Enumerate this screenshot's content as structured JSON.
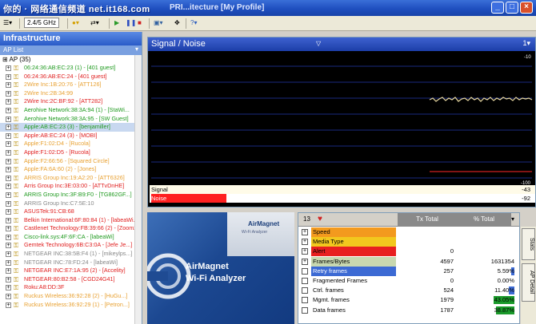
{
  "window": {
    "watermark": "你的 · 网络通信频道 net.it168.com",
    "title": "PRI...itecture [My Profile]"
  },
  "toolbar": {
    "band": "2.4/5 GHz",
    "items": [
      "☰▾",
      "2.4/5 GHz",
      "●▾",
      "⇄▾",
      "▶",
      "❚❚",
      "■",
      "▣▾",
      "✥",
      "?▾"
    ]
  },
  "left": {
    "header": "Infrastructure",
    "subheader": "AP List",
    "root": "AP (35)",
    "items": [
      {
        "label": "06:24:36:AB:EC:23 (1) - [401 guest]",
        "color": "#1f9a1f"
      },
      {
        "label": "06:24:36:AB:EC:24 - [401 guest]",
        "color": "#e02020"
      },
      {
        "label": "2Wire Inc:1B:20:76 - [ATT126]",
        "color": "#e8a030"
      },
      {
        "label": "2Wire Inc:2B:34:99",
        "color": "#e8a030"
      },
      {
        "label": "2Wire Inc:2C:BF:92 - [ATT282]",
        "color": "#e02020"
      },
      {
        "label": "Aerohive Network:38:3A:94 (1) - [StaWi...",
        "color": "#1f9a1f"
      },
      {
        "label": "Aerohive Network:38:3A:95 - [SW Guest]",
        "color": "#1f9a1f"
      },
      {
        "label": "Apple:AB:EC:23 (3) - [benjamiller]",
        "color": "#1f9a1f"
      },
      {
        "label": "Apple:AB:EC:24 (3) - [MOBI]",
        "color": "#e02020"
      },
      {
        "label": "Apple:F1:02:D4 - [Rucola]",
        "color": "#e8a030"
      },
      {
        "label": "Apple:F1:02:D5 - [Rucola]",
        "color": "#e02020"
      },
      {
        "label": "Apple:F2:66:56 - [Squared Circle]",
        "color": "#e8a030"
      },
      {
        "label": "Apple:FA:6A:60 (2) - [Jones]",
        "color": "#e8a030"
      },
      {
        "label": "ARRIS Group Inc:19:A2:20 - [ATT6326]",
        "color": "#e8a030"
      },
      {
        "label": "Arris Group Inc:3E:03:00 - [ATTvDnHE]",
        "color": "#e02020"
      },
      {
        "label": "ARRIS Group Inc:3F:B9:F0 - [TG862GF...]",
        "color": "#1f9a1f"
      },
      {
        "label": "ARRIS Group Inc:C7:5E:10",
        "color": "#888888"
      },
      {
        "label": "ASUSTek:91:CB:68",
        "color": "#e02020"
      },
      {
        "label": "Belkin International:6F:80:84 (1) - [labeaWi...]",
        "color": "#e02020"
      },
      {
        "label": "Castlenet Technology:FB:39:66 (2) - [Zoom2...]",
        "color": "#e02020"
      },
      {
        "label": "Cisco-link.sys:4F:6F:CA - [labeaWi]",
        "color": "#1f9a1f"
      },
      {
        "label": "Gemtek Technology:6B:C3:0A - [Jefe Je...]",
        "color": "#e02020"
      },
      {
        "label": "NETGEAR INC:38:5B:F4 (1) - [mikeylps...]",
        "color": "#888888"
      },
      {
        "label": "NETGEAR INC:78:FD:24 - [labeaWi]",
        "color": "#888888"
      },
      {
        "label": "NETGEAR INC:E7:1A:95 (2) - [Accelity]",
        "color": "#e02020"
      },
      {
        "label": "NETGEAR:80:B2:58 - [CGD24G41]",
        "color": "#e02020"
      },
      {
        "label": "Roku:A8:DD:3F",
        "color": "#e02020"
      },
      {
        "label": "Ruckus Wireless:36:92:28 (2) - [HuGu...]",
        "color": "#e8a030"
      },
      {
        "label": "Ruckus Wireless:36:92:29 (1) - [Petron...]",
        "color": "#e8a030"
      }
    ]
  },
  "signal": {
    "title": "Signal / Noise",
    "right": "1▾",
    "top_scale": "-10",
    "bottom_scale": "-100",
    "rows": [
      {
        "label": "Signal",
        "value": "-43",
        "color": "#ffffff"
      },
      {
        "label": "Noise",
        "value": "-92",
        "color": "#ff3030"
      }
    ]
  },
  "magnet": {
    "brand_line1": "AirMagnet",
    "brand_line2": "Wi-Fi Analyzer",
    "side1": "AirMagnet",
    "side2": "Wi-Fi Analyzer"
  },
  "stats": {
    "count": "13",
    "col1": "Tx Total",
    "col2": "% Total",
    "rows": [
      {
        "label": "Speed",
        "v1": "",
        "v2": "",
        "bg": "#f39a1e"
      },
      {
        "label": "Media Type",
        "v1": "",
        "v2": "",
        "bg": "#f2c81e"
      },
      {
        "label": "Alert",
        "v1": "0",
        "v2": "",
        "bg": "#e82020"
      },
      {
        "label": "Frames/Bytes",
        "v1": "4597",
        "v2": "1631354",
        "bg": "#c8d8b0"
      },
      {
        "label": "Retry frames",
        "v1": "257",
        "v2": "5.59%",
        "bg": "#3c6ad4",
        "pct": 5.59
      },
      {
        "label": "Fragmented Frames",
        "v1": "0",
        "v2": "0.00%",
        "bg": "#ffffff",
        "pct": 0
      },
      {
        "label": "Ctrl. frames",
        "v1": "524",
        "v2": "11.40%",
        "bg": "#ffffff",
        "pct": 11.4
      },
      {
        "label": "Mgmt. frames",
        "v1": "1979",
        "v2": "43.05%",
        "bg": "#ffffff",
        "pct": 43.05
      },
      {
        "label": "Data frames",
        "v1": "1787",
        "v2": "38.87%",
        "bg": "#ffffff",
        "pct": 38.87
      }
    ]
  },
  "side_tabs": [
    "Stats",
    "AP Detail"
  ]
}
